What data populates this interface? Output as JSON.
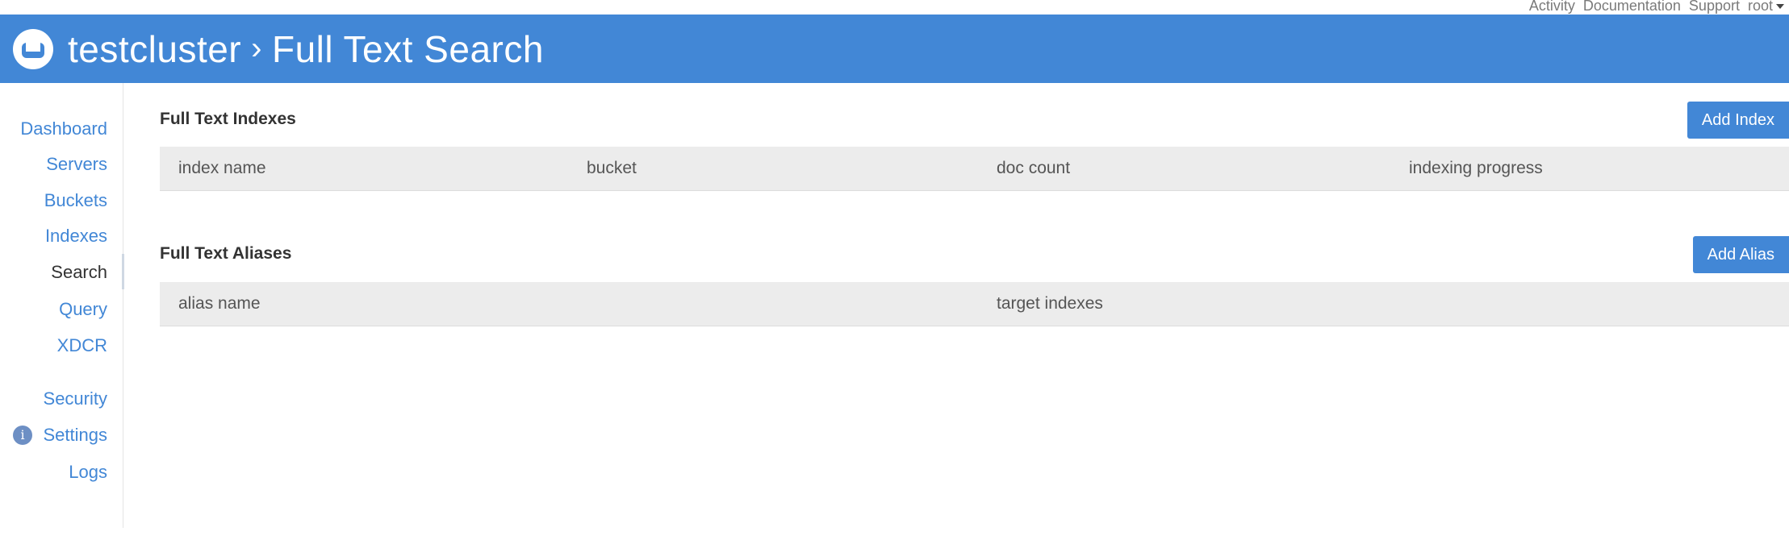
{
  "top_nav": {
    "links": [
      "Activity",
      "Documentation",
      "Support",
      "root"
    ]
  },
  "header": {
    "cluster": "testcluster",
    "separator": "›",
    "page": "Full Text Search"
  },
  "sidebar": {
    "items": [
      {
        "label": "Dashboard",
        "active": false
      },
      {
        "label": "Servers",
        "active": false
      },
      {
        "label": "Buckets",
        "active": false
      },
      {
        "label": "Indexes",
        "active": false
      },
      {
        "label": "Search",
        "active": true
      },
      {
        "label": "Query",
        "active": false
      },
      {
        "label": "XDCR",
        "active": false
      },
      {
        "label": "Security",
        "active": false
      },
      {
        "label": "Settings",
        "active": false
      },
      {
        "label": "Logs",
        "active": false
      }
    ],
    "info_badge": "i"
  },
  "indexes_section": {
    "title": "Full Text Indexes",
    "button": "Add Index",
    "columns": [
      "index name",
      "bucket",
      "doc count",
      "indexing progress"
    ],
    "rows": []
  },
  "aliases_section": {
    "title": "Full Text Aliases",
    "button": "Add Alias",
    "columns": [
      "alias name",
      "target indexes"
    ],
    "rows": []
  },
  "colors": {
    "accent": "#4287d6",
    "table_header_bg": "#ececec",
    "active_nav_text": "#333333"
  }
}
